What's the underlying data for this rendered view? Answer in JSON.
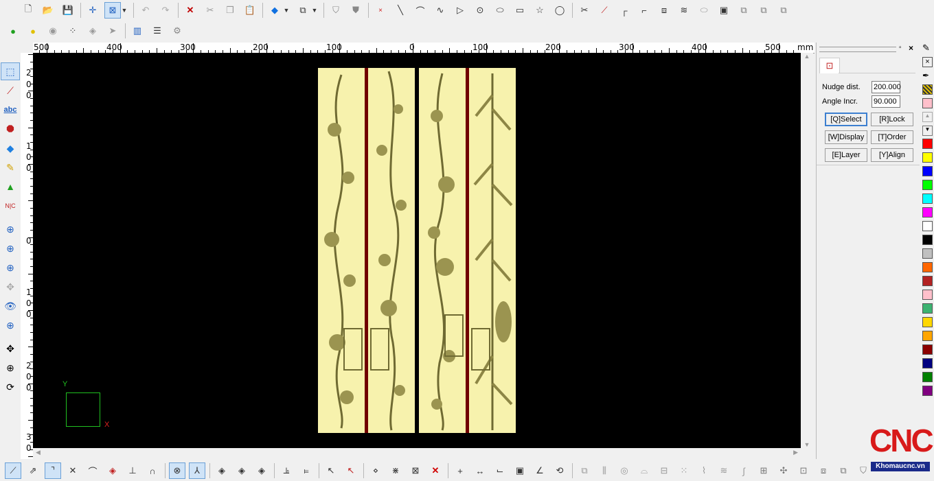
{
  "toolbar_top": {
    "row1": [
      "new-icon",
      "open-icon",
      "save-icon",
      "snap-cross-icon",
      "selection-box-icon",
      "dropdown-icon",
      "undo-icon",
      "redo-icon",
      "delete-icon",
      "cut-icon",
      "copy-icon",
      "paste-icon",
      "view-cube-icon",
      "view-3d-icon",
      "shield-icon",
      "shield-filled-icon",
      "point-icon",
      "line-icon",
      "arc-icon",
      "curve-icon",
      "triangle-icon",
      "circle-point-icon",
      "ellipse-icon",
      "rectangle-icon",
      "star-icon",
      "circle-icon",
      "trim-icon",
      "extend-icon",
      "fillet-icon",
      "chamfer-icon",
      "offset-icon",
      "blend-icon",
      "slot-icon",
      "frame-icon",
      "array-icon",
      "copy-array-icon",
      "mirror-icon"
    ],
    "row2": [
      "bulb-green-icon",
      "bulb-yellow-icon",
      "bulb-off-icon",
      "toggle-icon",
      "diamond-icon",
      "arrow-right-icon",
      "layer-book-icon",
      "grid-lines-icon",
      "settings-icon"
    ]
  },
  "ruler": {
    "unit": "mm",
    "labels": [
      "500",
      "400",
      "300",
      "200",
      "100",
      "0",
      "100",
      "200",
      "300",
      "400",
      "500"
    ]
  },
  "left_ruler_digits": [
    "2",
    "0",
    "0",
    "1",
    "0",
    "0",
    "0",
    "1",
    "0",
    "0",
    "2",
    "0",
    "0",
    "3",
    "0"
  ],
  "left_toolbar": [
    "select-node-icon",
    "node-edit-icon",
    "text-abc-icon",
    "octagon-icon",
    "paint-bucket-icon",
    "pencil-icon",
    "bell-icon",
    "nc-icon",
    "zoom-window-icon",
    "zoom-in-icon",
    "zoom-fit-icon",
    "pan-view-icon",
    "eye-icon",
    "zoom-all-icon",
    "move-icon",
    "zoom-icon",
    "rotate-icon"
  ],
  "axis": {
    "y": "Y",
    "x": "X"
  },
  "properties_panel": {
    "nudge_label": "Nudge dist.",
    "nudge_value": "200.000",
    "angle_label": "Angle Incr.",
    "angle_value": "90.000",
    "buttons": {
      "select": "[Q]Select",
      "lock": "[R]Lock",
      "display": "[W]Display",
      "order": "[T]Order",
      "layer": "[E]Layer",
      "align": "[Y]Align"
    }
  },
  "palette": [
    "#ff0000",
    "#ffff00",
    "#0000ff",
    "#00ff00",
    "#00ffff",
    "#ff00ff",
    "#ffffff",
    "#000000",
    "#c0c0c0",
    "#ff6600",
    "#b22222",
    "#ffc0cb",
    "#3cb371",
    "#ffd700",
    "#ffa500",
    "#8b0000",
    "#000080",
    "#008000",
    "#800080"
  ],
  "logo": {
    "text": "CNC",
    "site": "Khomaucnc.vn"
  },
  "bottom_toolbar": [
    "line-snap-icon",
    "multi-snap-icon",
    "corner-icon",
    "cross-icon",
    "arc-snap-icon",
    "circle-snap-icon",
    "perpendicular-icon",
    "tangent-icon",
    "center-point-icon",
    "intersection-icon",
    "diamond-1-icon",
    "diamond-2-icon",
    "diamond-3-icon",
    "align-bottom-icon",
    "align-left-icon",
    "cursor-icon",
    "cursor-x-icon",
    "node-1-icon",
    "node-2-icon",
    "node-3-icon",
    "close-red-icon",
    "plus-icon",
    "width-icon",
    "corner-dim-icon",
    "box-dim-icon",
    "angle-dim-icon",
    "radius-dim-icon",
    "group-1-icon",
    "group-2-icon",
    "group-3-icon",
    "group-4-icon",
    "group-5-icon",
    "group-6-icon",
    "group-7-icon",
    "group-8-icon",
    "group-9-icon",
    "group-10-icon",
    "group-11-icon",
    "group-12-icon",
    "group-13-icon",
    "group-14-icon",
    "group-15-icon"
  ]
}
